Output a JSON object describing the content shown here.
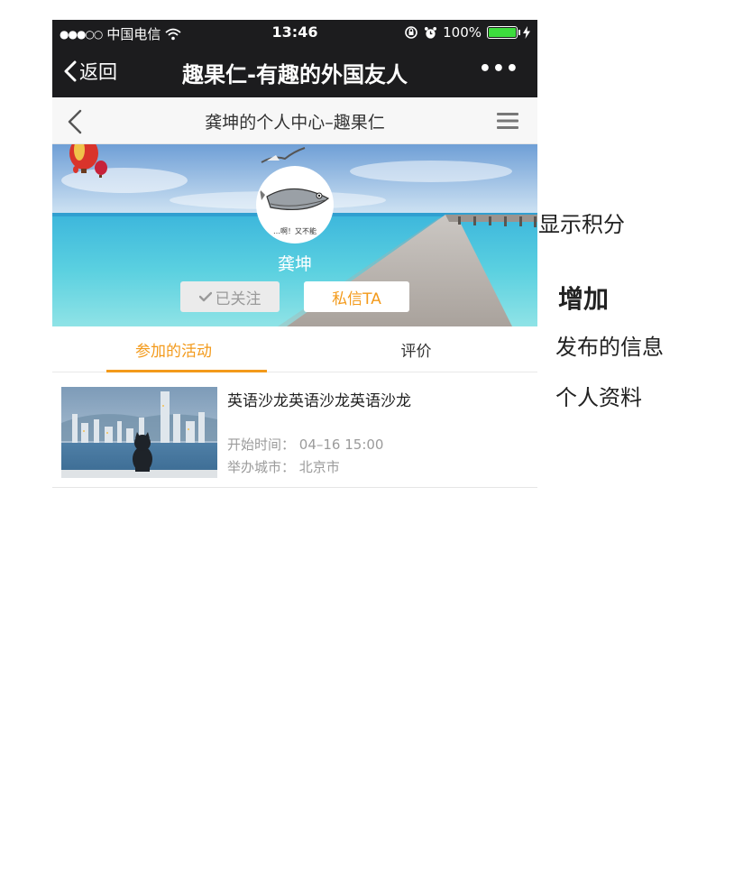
{
  "status_bar": {
    "signal": "●●●○○",
    "carrier": "中国电信",
    "time": "13:46",
    "battery": "100%",
    "battery_level": 1.0,
    "battery_color": "#3ddc3d"
  },
  "wechat_nav": {
    "back_label": "返回",
    "title": "趣果仁-有趣的外国友人",
    "more": "•••"
  },
  "page_header": {
    "title": "龚坤的个人中心–趣果仁"
  },
  "profile": {
    "avatar_caption": "…啊！又不能",
    "username": "龚坤",
    "follow_button": "已关注",
    "message_button": "私信TA"
  },
  "tabs": [
    {
      "label": "参加的活动",
      "active": true
    },
    {
      "label": "评价",
      "active": false
    }
  ],
  "activity": {
    "title": "英语沙龙英语沙龙英语沙龙",
    "start_time_label": "开始时间：",
    "start_time": "04–16 15:00",
    "city_label": "举办城市：",
    "city": "北京市"
  },
  "annotations": {
    "show_points": "显示积分",
    "add": "增加",
    "posted_info": "发布的信息",
    "personal_info": "个人资料"
  },
  "colors": {
    "accent": "#f39a1b",
    "nav_bg": "#1c1c1e"
  }
}
